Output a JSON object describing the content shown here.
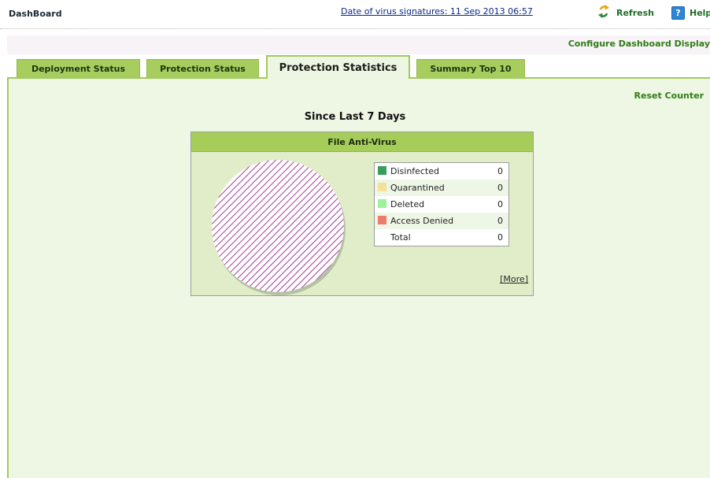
{
  "header": {
    "title": "DashBoard",
    "signature_date": "Date of virus signatures: 11 Sep 2013 06:57",
    "refresh_label": "Refresh",
    "help_label": "Help"
  },
  "config_link": "Configure Dashboard Display",
  "tabs": [
    {
      "label": "Deployment Status",
      "active": false
    },
    {
      "label": "Protection Status",
      "active": false
    },
    {
      "label": "Protection Statistics",
      "active": true
    },
    {
      "label": "Summary Top 10",
      "active": false
    }
  ],
  "panel": {
    "reset_label": "Reset Counter",
    "period_title": "Since Last 7 Days",
    "card": {
      "title": "File Anti-Virus",
      "legend": [
        {
          "label": "Disinfected",
          "value": "0",
          "color": "#3a9d5d"
        },
        {
          "label": "Quarantined",
          "value": "0",
          "color": "#f5e09a"
        },
        {
          "label": "Deleted",
          "value": "0",
          "color": "#9ef09a"
        },
        {
          "label": "Access Denied",
          "value": "0",
          "color": "#f07a6c"
        },
        {
          "label": "Total",
          "value": "0",
          "color": ""
        }
      ],
      "more_label": "[More]",
      "pie_pattern_color": "#a23a9a"
    }
  }
}
